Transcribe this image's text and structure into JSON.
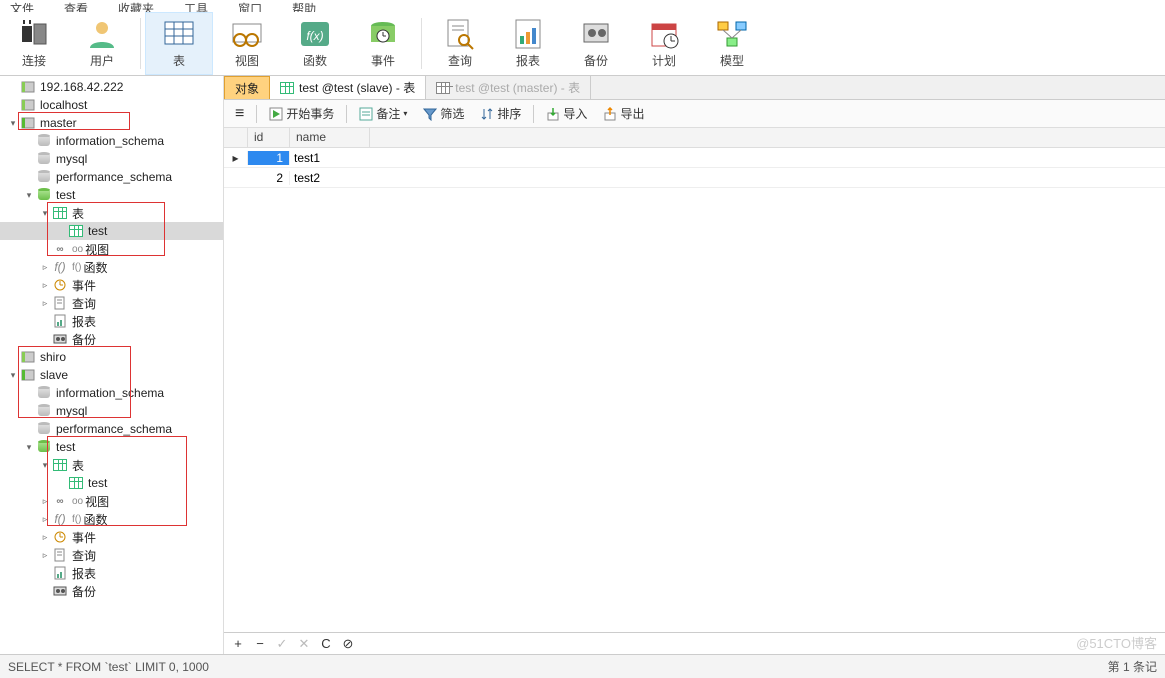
{
  "topmenu": [
    "文件",
    "查看",
    "收藏夹",
    "工具",
    "窗口",
    "帮助"
  ],
  "ribbon": [
    {
      "label": "连接",
      "icon": "plug-icon"
    },
    {
      "label": "用户",
      "icon": "user-icon"
    },
    {
      "label": "表",
      "icon": "table-icon",
      "active": true
    },
    {
      "label": "视图",
      "icon": "view-icon"
    },
    {
      "label": "函数",
      "icon": "function-icon"
    },
    {
      "label": "事件",
      "icon": "event-icon"
    },
    {
      "label": "查询",
      "icon": "query-icon"
    },
    {
      "label": "报表",
      "icon": "report-icon"
    },
    {
      "label": "备份",
      "icon": "backup-icon"
    },
    {
      "label": "计划",
      "icon": "schedule-icon"
    },
    {
      "label": "模型",
      "icon": "model-icon"
    }
  ],
  "tree": [
    {
      "d": 0,
      "a": "",
      "i": "conn",
      "t": "192.168.42.222"
    },
    {
      "d": 0,
      "a": "",
      "i": "conn",
      "t": "localhost"
    },
    {
      "d": 0,
      "a": "▾",
      "i": "conn-g",
      "t": "master"
    },
    {
      "d": 1,
      "a": "",
      "i": "db",
      "t": "information_schema"
    },
    {
      "d": 1,
      "a": "",
      "i": "db",
      "t": "mysql"
    },
    {
      "d": 1,
      "a": "",
      "i": "db",
      "t": "performance_schema"
    },
    {
      "d": 1,
      "a": "▾",
      "i": "db-g",
      "t": "test"
    },
    {
      "d": 2,
      "a": "▾",
      "i": "folder-table",
      "t": "表"
    },
    {
      "d": 3,
      "a": "",
      "i": "table",
      "t": "test",
      "sel": true
    },
    {
      "d": 2,
      "a": "",
      "i": "view",
      "t": "视图",
      "pre": "oo"
    },
    {
      "d": 2,
      "a": "▹",
      "i": "fn",
      "t": "函数",
      "pre": "f()"
    },
    {
      "d": 2,
      "a": "▹",
      "i": "event",
      "t": "事件"
    },
    {
      "d": 2,
      "a": "▹",
      "i": "query",
      "t": "查询"
    },
    {
      "d": 2,
      "a": "",
      "i": "report",
      "t": "报表"
    },
    {
      "d": 2,
      "a": "",
      "i": "backup",
      "t": "备份"
    },
    {
      "d": 0,
      "a": "",
      "i": "conn",
      "t": "shiro"
    },
    {
      "d": 0,
      "a": "▾",
      "i": "conn-g",
      "t": "slave"
    },
    {
      "d": 1,
      "a": "",
      "i": "db",
      "t": "information_schema"
    },
    {
      "d": 1,
      "a": "",
      "i": "db",
      "t": "mysql"
    },
    {
      "d": 1,
      "a": "",
      "i": "db",
      "t": "performance_schema"
    },
    {
      "d": 1,
      "a": "▾",
      "i": "db-g",
      "t": "test"
    },
    {
      "d": 2,
      "a": "▾",
      "i": "folder-table",
      "t": "表"
    },
    {
      "d": 3,
      "a": "",
      "i": "table",
      "t": "test"
    },
    {
      "d": 2,
      "a": "▹",
      "i": "view",
      "t": "视图",
      "pre": "oo"
    },
    {
      "d": 2,
      "a": "▹",
      "i": "fn",
      "t": "函数",
      "pre": "f()"
    },
    {
      "d": 2,
      "a": "▹",
      "i": "event",
      "t": "事件"
    },
    {
      "d": 2,
      "a": "▹",
      "i": "query",
      "t": "查询"
    },
    {
      "d": 2,
      "a": "",
      "i": "report",
      "t": "报表"
    },
    {
      "d": 2,
      "a": "",
      "i": "backup",
      "t": "备份"
    }
  ],
  "tabs": {
    "object": "对象",
    "active": "test @test (slave) - 表",
    "inactive": "test @test (master) - 表"
  },
  "toolbar": {
    "menu": "≡",
    "begin_tx": "开始事务",
    "memo": "备注",
    "memo_dd": "▾",
    "filter": "筛选",
    "sort": "排序",
    "import": "导入",
    "export": "导出"
  },
  "grid": {
    "cols": [
      "id",
      "name"
    ],
    "rows": [
      {
        "id": "1",
        "name": "test1",
        "cur": true
      },
      {
        "id": "2",
        "name": "test2"
      }
    ]
  },
  "bottombar": [
    "+",
    "−",
    "✓",
    "✕",
    "C",
    "⊘"
  ],
  "status_left": "SELECT * FROM `test` LIMIT 0, 1000",
  "status_right": "第 1 条记",
  "watermark": "@51CTO博客"
}
